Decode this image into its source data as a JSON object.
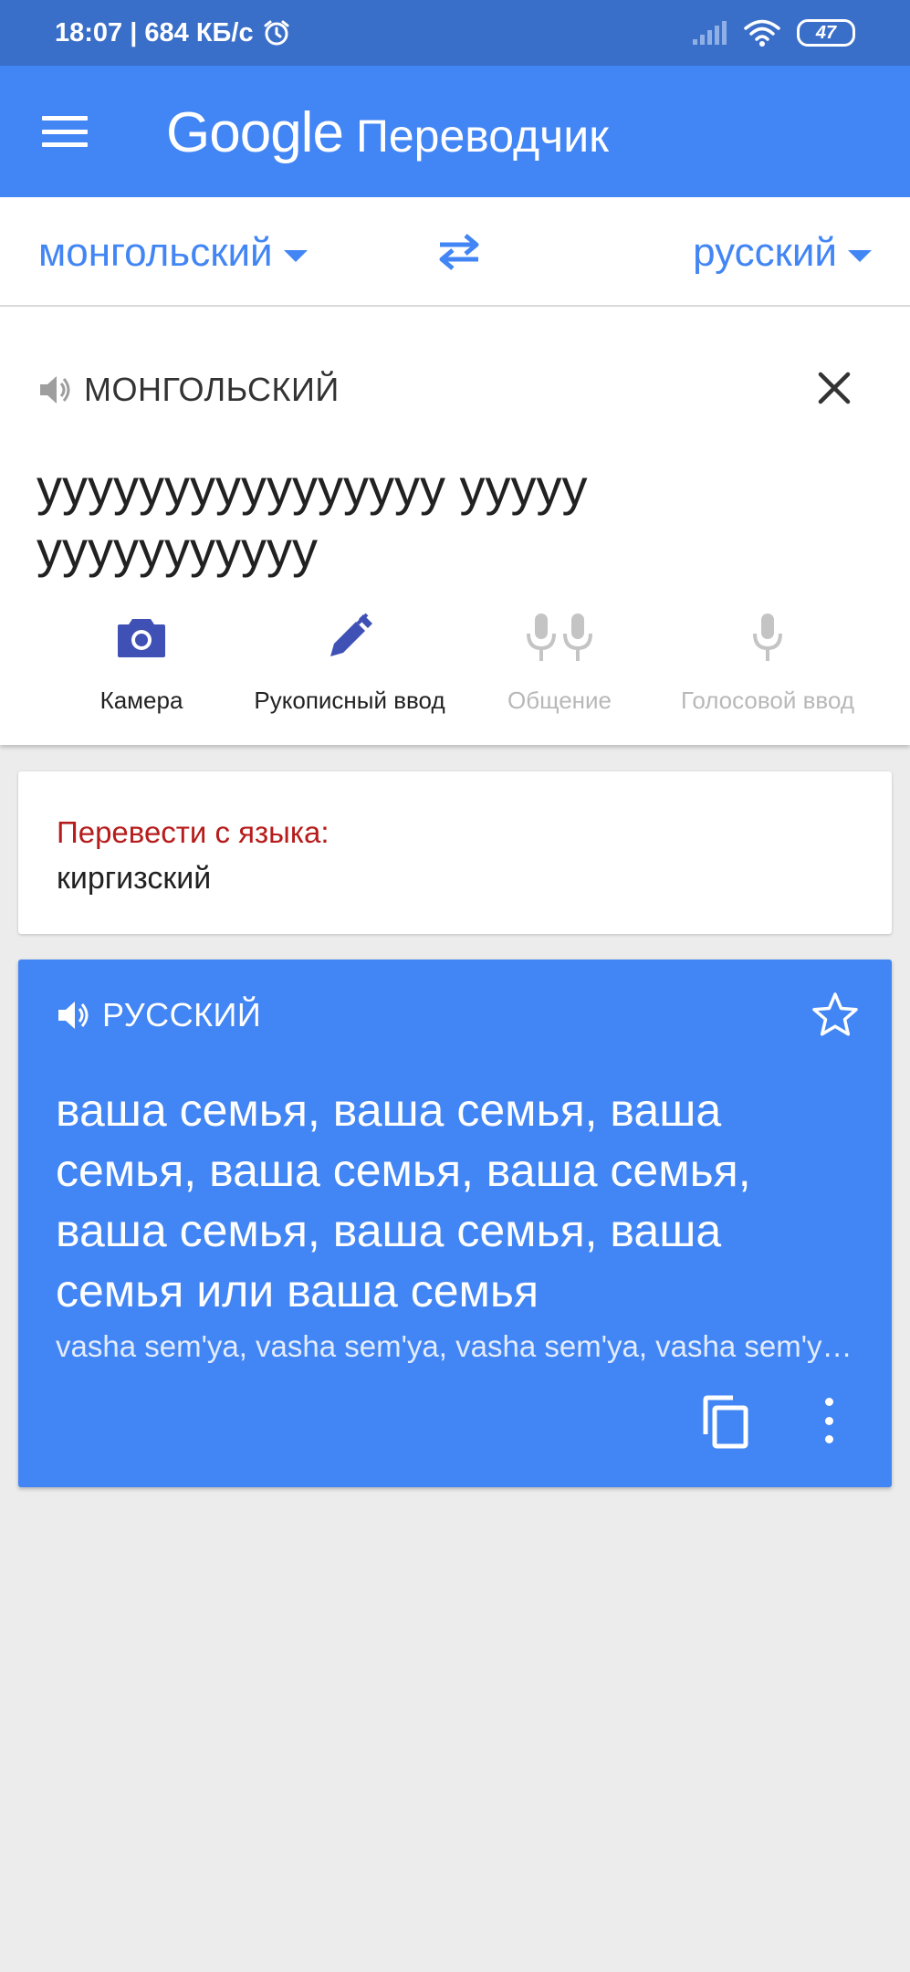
{
  "status_bar": {
    "time_speed": "18:07 | 684 КБ/с",
    "battery": "47"
  },
  "app_bar": {
    "brand": "Google",
    "product": "Переводчик"
  },
  "languages": {
    "source": "монгольский",
    "target": "русский"
  },
  "input": {
    "label": "МОНГОЛЬСКИЙ",
    "text": "уууууууууууууууу ууууу ууууууууууу"
  },
  "tools": [
    {
      "label": "Камера",
      "icon": "camera-icon",
      "enabled": true
    },
    {
      "label": "Рукописный ввод",
      "icon": "pen-icon",
      "enabled": true
    },
    {
      "label": "Общение",
      "icon": "conversation-mic-icon",
      "enabled": false
    },
    {
      "label": "Голосовой ввод",
      "icon": "mic-icon",
      "enabled": false
    }
  ],
  "suggestion": {
    "title": "Перевести с языка:",
    "language": "киргизский"
  },
  "result": {
    "label": "РУССКИЙ",
    "text": "ваша семья, ваша семья, ваша семья, ваша семья, ваша семья, ваша семья, ваша семья, ваша семья или ваша семья",
    "transliteration": "vasha sem'ya, vasha sem'ya, vasha sem'ya, vasha sem'ya, vasha sem'ya, vasha sem'ya, vasha sem'ya, vasha sem'ya ili vasha sem'ya"
  },
  "colors": {
    "app_bar": "#4285f4",
    "status_bar": "#3a6fc9",
    "accent": "#4285f4",
    "icon_active": "#3f51b5",
    "suggestion_title": "#b71c1c"
  }
}
